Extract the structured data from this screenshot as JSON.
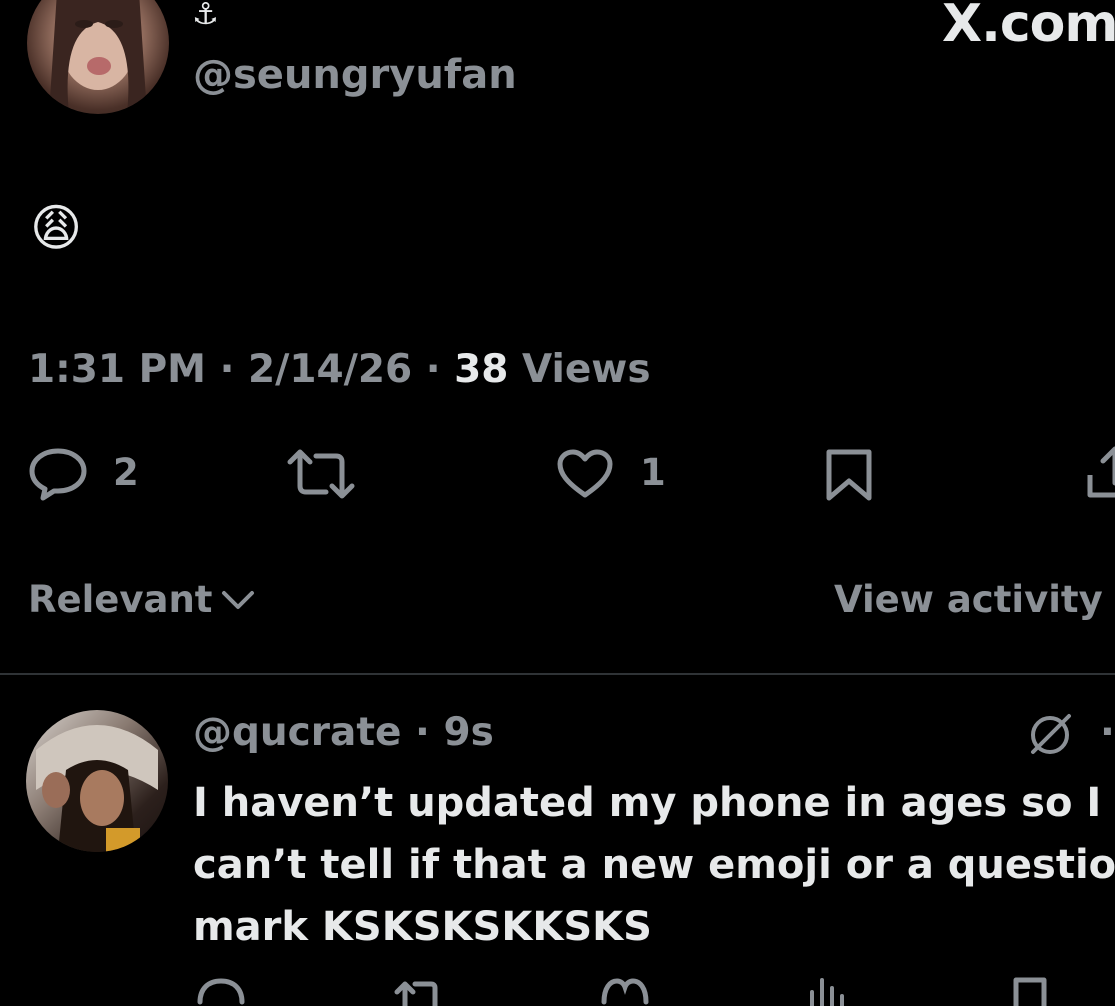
{
  "header": {
    "brand": "X.com",
    "author_badge": "⚓",
    "author_handle": "@seungryufan"
  },
  "post": {
    "emoji": "😩",
    "time": "1:31 PM",
    "sep1": "·",
    "date": "2/14/26",
    "sep2": "·",
    "views_count": "38",
    "views_label": "Views",
    "reply_count": "2",
    "like_count": "1"
  },
  "replies_bar": {
    "sort_label": "Relevant",
    "activity_label": "View activity"
  },
  "reply": {
    "handle": "@qucrate",
    "sep": "·",
    "age": "9s",
    "more": "·",
    "text_line1": "I haven’t updated my phone in ages so I",
    "text_line2": "can’t tell if that a new emoji or a questio",
    "text_line3": "mark KSKSKSKKSKS"
  }
}
